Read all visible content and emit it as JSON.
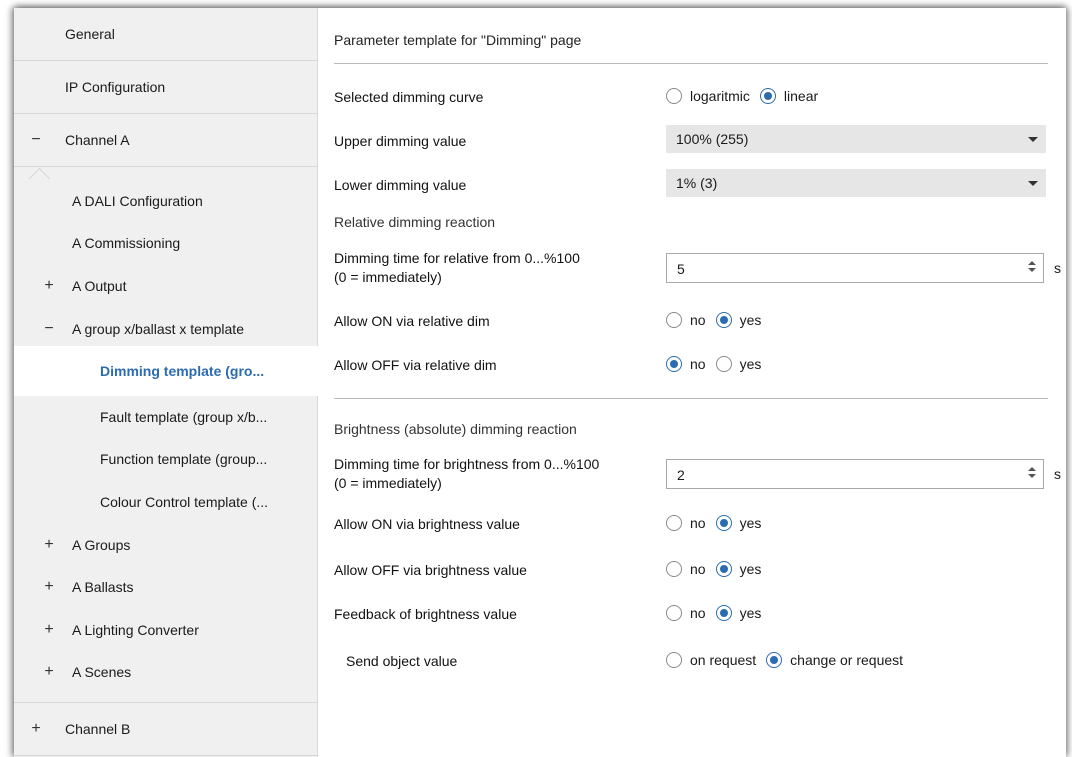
{
  "sidebar": {
    "items": [
      {
        "label": "General",
        "expander": ""
      },
      {
        "label": "IP Configuration",
        "expander": ""
      },
      {
        "label": "Channel A",
        "expander": "−"
      },
      {
        "label": "A DALI Configuration",
        "expander": ""
      },
      {
        "label": "A Commissioning",
        "expander": ""
      },
      {
        "label": "A Output",
        "expander": "+"
      },
      {
        "label": "A group x/ballast x template",
        "expander": "−"
      },
      {
        "label": "Dimming template (gro...",
        "expander": ""
      },
      {
        "label": "Fault template  (group x/b...",
        "expander": ""
      },
      {
        "label": "Function template (group...",
        "expander": ""
      },
      {
        "label": "Colour Control template (...",
        "expander": ""
      },
      {
        "label": "A Groups",
        "expander": "+"
      },
      {
        "label": "A Ballasts",
        "expander": "+"
      },
      {
        "label": "A Lighting Converter",
        "expander": "+"
      },
      {
        "label": "A Scenes",
        "expander": "+"
      },
      {
        "label": "Channel B",
        "expander": "+"
      }
    ]
  },
  "main": {
    "title": "Parameter template for \"Dimming\" page",
    "dimming_curve": {
      "label": "Selected dimming curve",
      "options": [
        "logaritmic",
        "linear"
      ],
      "selected": "linear"
    },
    "upper_dimming": {
      "label": "Upper dimming value",
      "value": "100% (255)"
    },
    "lower_dimming": {
      "label": "Lower dimming value",
      "value": "1% (3)"
    },
    "relative_section": "Relative dimming reaction",
    "relative_time": {
      "label_line1": "Dimming time for relative from 0...%100",
      "label_line2": "(0 = immediately)",
      "value": "5",
      "unit": "s"
    },
    "allow_on_relative": {
      "label": "Allow ON via relative dim",
      "options": [
        "no",
        "yes"
      ],
      "selected": "yes"
    },
    "allow_off_relative": {
      "label": "Allow OFF via relative dim",
      "options": [
        "no",
        "yes"
      ],
      "selected": "no"
    },
    "brightness_section": "Brightness (absolute) dimming reaction",
    "brightness_time": {
      "label_line1": "Dimming time for brightness from 0...%100",
      "label_line2": "(0 = immediately)",
      "value": "2",
      "unit": "s"
    },
    "allow_on_brightness": {
      "label": "Allow ON via brightness value",
      "options": [
        "no",
        "yes"
      ],
      "selected": "yes"
    },
    "allow_off_brightness": {
      "label": "Allow OFF via brightness value",
      "options": [
        "no",
        "yes"
      ],
      "selected": "yes"
    },
    "feedback_brightness": {
      "label": "Feedback of brightness value",
      "options": [
        "no",
        "yes"
      ],
      "selected": "yes"
    },
    "send_object_value": {
      "label": "Send object value",
      "options": [
        "on request",
        "change or request"
      ],
      "selected": "change or request"
    }
  },
  "colors": {
    "accent": "#2b6cb0",
    "sidebar_bg": "#f0f0f0"
  }
}
